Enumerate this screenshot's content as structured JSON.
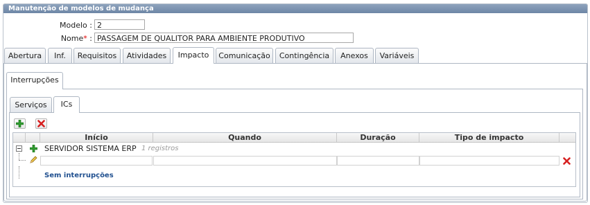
{
  "window": {
    "title": "Manutenção de modelos de mudança"
  },
  "form": {
    "modelo_label": "Modelo :",
    "modelo_value": "2",
    "nome_label": "Nome",
    "nome_required": "*",
    "nome_colon": ":",
    "nome_value": "PASSAGEM DE QUALITOR PARA AMBIENTE PRODUTIVO"
  },
  "tabs": [
    {
      "label": "Abertura"
    },
    {
      "label": "Inf."
    },
    {
      "label": "Requisitos"
    },
    {
      "label": "Atividades"
    },
    {
      "label": "Impacto",
      "active": true
    },
    {
      "label": "Comunicação"
    },
    {
      "label": "Contingência"
    },
    {
      "label": "Anexos"
    },
    {
      "label": "Variáveis"
    }
  ],
  "section_tab": {
    "label": "Interrupções"
  },
  "subtabs": [
    {
      "label": "Serviços"
    },
    {
      "label": "ICs",
      "active": true
    }
  ],
  "toolbar": {
    "add_icon": "plus-icon",
    "delete_icon": "delete-x-icon"
  },
  "grid": {
    "columns": [
      "Início",
      "Quando",
      "Duração",
      "Tipo de impacto"
    ],
    "group_row": {
      "label": "SERVIDOR SISTEMA ERP",
      "count": "1 registros"
    },
    "footer_link": "Sem interrupções"
  },
  "colors": {
    "titlebar": "#7189aa",
    "delete": "#d62020",
    "add": "#2f9a2f",
    "link": "#1f4f8f"
  }
}
